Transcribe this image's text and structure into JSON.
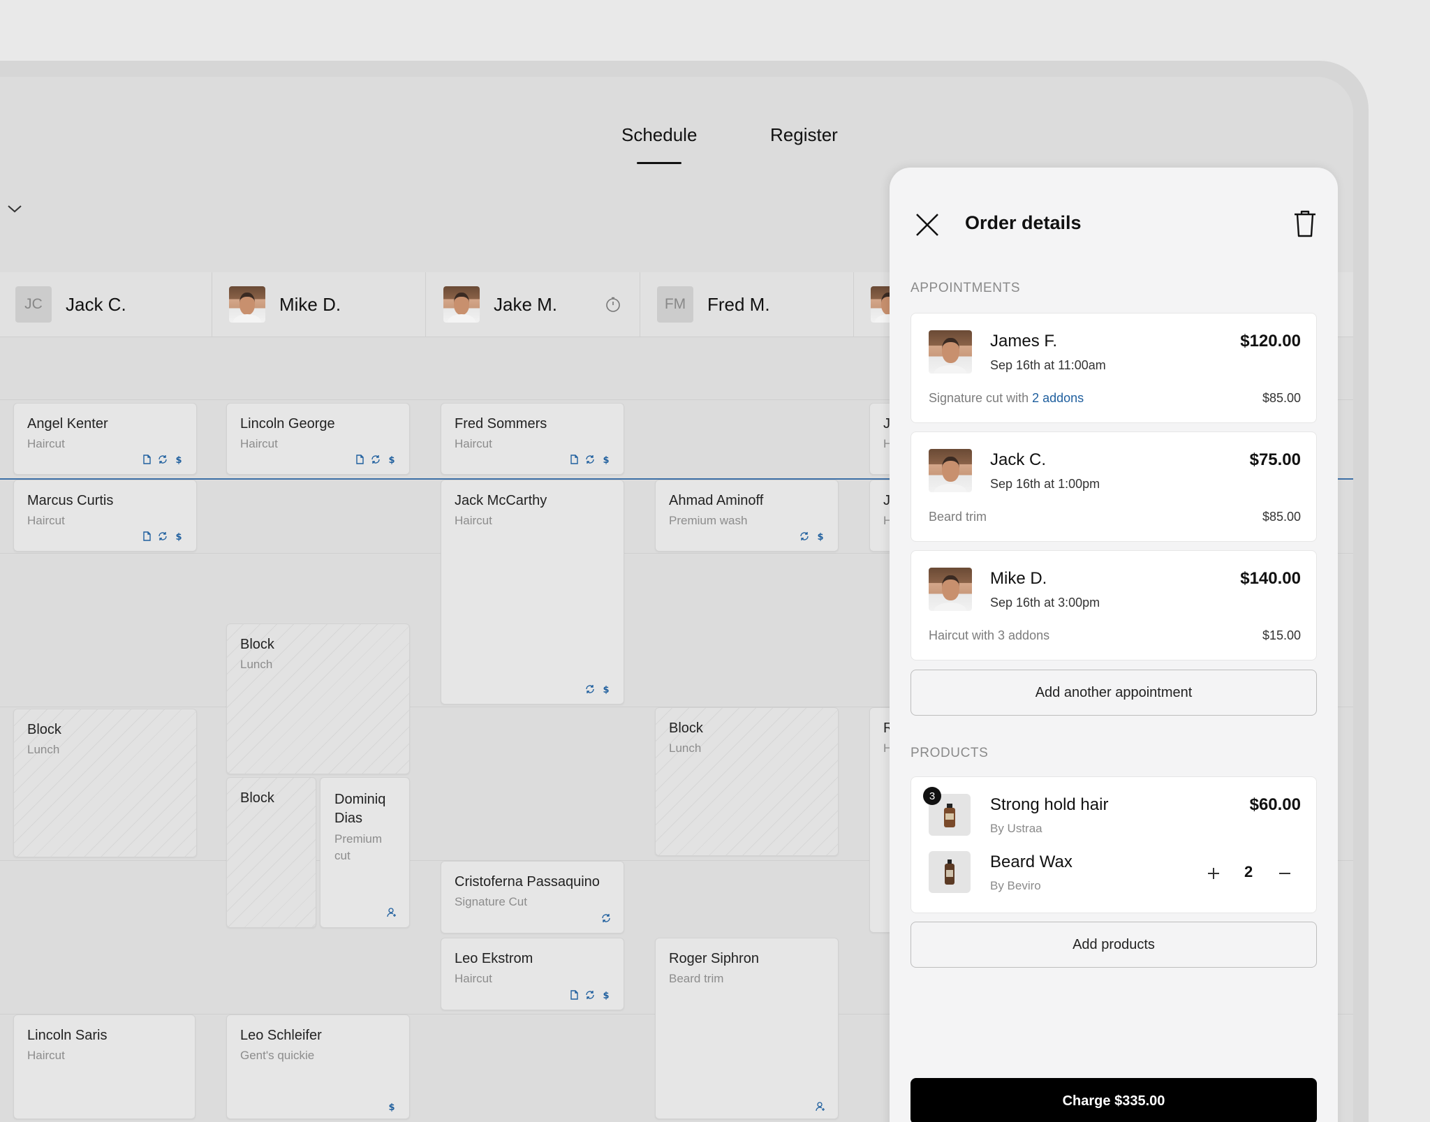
{
  "nav": {
    "tabs": [
      {
        "label": "Schedule",
        "active": true
      },
      {
        "label": "Register",
        "active": false
      }
    ]
  },
  "staff": [
    {
      "initials": "JC",
      "name": "Jack C."
    },
    {
      "name": "Mike D.",
      "avatar": "photo"
    },
    {
      "name": "Jake M.",
      "avatar": "photo",
      "icon": "timer-icon"
    },
    {
      "initials": "FM",
      "name": "Fred M."
    },
    {
      "name": "",
      "avatar": "photo"
    }
  ],
  "appointments": [
    {
      "name": "Angel Kenter",
      "service": "Haircut",
      "icons": [
        "note-icon",
        "repeat-icon",
        "dollar-icon"
      ]
    },
    {
      "name": "Marcus Curtis",
      "service": "Haircut",
      "icons": [
        "note-icon",
        "repeat-icon",
        "dollar-icon"
      ]
    },
    {
      "name": "Block",
      "service": "Lunch"
    },
    {
      "name": "Lincoln Saris",
      "service": "Haircut"
    },
    {
      "name": "Lincoln George",
      "service": "Haircut",
      "icons": [
        "note-icon",
        "repeat-icon",
        "dollar-icon"
      ]
    },
    {
      "name": "Block",
      "service": "Lunch"
    },
    {
      "name": "Block",
      "service": ""
    },
    {
      "name": "Dominiq Dias",
      "service": "Premium cut",
      "icons": [
        "person-add-icon"
      ]
    },
    {
      "name": "Leo Schleifer",
      "service": "Gent's quickie",
      "icons": [
        "dollar-icon"
      ]
    },
    {
      "name": "Fred Sommers",
      "service": "Haircut",
      "icons": [
        "note-icon",
        "repeat-icon",
        "dollar-icon"
      ]
    },
    {
      "name": "Jack McCarthy",
      "service": "Haircut",
      "icons": [
        "repeat-icon",
        "dollar-icon"
      ]
    },
    {
      "name": "Cristoferna Passaquino",
      "service": "Signature Cut",
      "icons": [
        "repeat-icon"
      ]
    },
    {
      "name": "Leo Ekstrom",
      "service": "Haircut",
      "icons": [
        "note-icon",
        "repeat-icon",
        "dollar-icon"
      ]
    },
    {
      "name": "Ahmad Aminoff",
      "service": "Premium wash",
      "icons": [
        "repeat-icon",
        "dollar-icon"
      ]
    },
    {
      "name": "Block",
      "service": "Lunch"
    },
    {
      "name": "Roger Siphron",
      "service": "Beard trim",
      "icons": [
        "person-add-icon"
      ]
    },
    {
      "name": "J",
      "service": "H"
    },
    {
      "name": "J",
      "service": "H"
    },
    {
      "name": "R",
      "service": "H"
    }
  ],
  "order": {
    "title": "Order details",
    "appointments_label": "APPOINTMENTS",
    "appointments": [
      {
        "name": "James F.",
        "time": "Sep 16th at 11:00am",
        "price": "$120.00",
        "desc": "Signature cut with ",
        "desc_link": "2 addons",
        "sub_price": "$85.00"
      },
      {
        "name": "Jack C.",
        "time": "Sep 16th at 1:00pm",
        "price": "$75.00",
        "desc": "Beard trim",
        "desc_link": "",
        "sub_price": "$85.00"
      },
      {
        "name": "Mike D.",
        "time": "Sep 16th at 3:00pm",
        "price": "$140.00",
        "desc": "Haircut with 3 addons",
        "desc_link": "",
        "sub_price": "$15.00"
      }
    ],
    "add_appointment_label": "Add another appointment",
    "products_label": "PRODUCTS",
    "products": [
      {
        "name": "Strong hold hair",
        "brand": "By Ustraa",
        "price": "$60.00",
        "badge": "3"
      },
      {
        "name": "Beard Wax",
        "brand": "By Beviro",
        "quantity": "2"
      }
    ],
    "add_products_label": "Add products",
    "charge_label": "Charge $335.00"
  },
  "colors": {
    "accent": "#3d6fa6",
    "link": "#1f5f9e",
    "charge_button": "#000000"
  }
}
